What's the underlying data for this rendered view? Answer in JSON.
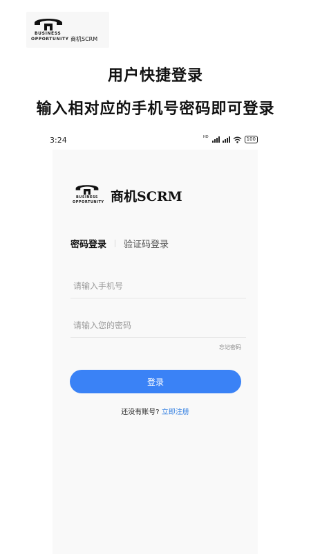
{
  "promo": {
    "brand_line1": "BUSINESS",
    "brand_line2": "OPPORTUNITY",
    "brand_name": "商机SCRM",
    "title": "用户快捷登录",
    "subtitle": "输入相对应的手机号密码即可登录"
  },
  "status_bar": {
    "time": "3:24",
    "network_label": "HD",
    "battery": "100"
  },
  "app": {
    "logo_line1": "BUSINESS",
    "logo_line2": "OPPORTUNITY",
    "name": "商机SCRM"
  },
  "tabs": [
    {
      "label": "密码登录",
      "active": true
    },
    {
      "label": "验证码登录",
      "active": false
    }
  ],
  "form": {
    "phone_placeholder": "请输入手机号",
    "password_placeholder": "请输入您的密码",
    "forgot_label": "忘记密码",
    "login_label": "登录"
  },
  "register": {
    "prompt": "还没有账号?",
    "link": "立即注册"
  },
  "colors": {
    "accent": "#3a82f6",
    "link": "#2f7de1"
  }
}
